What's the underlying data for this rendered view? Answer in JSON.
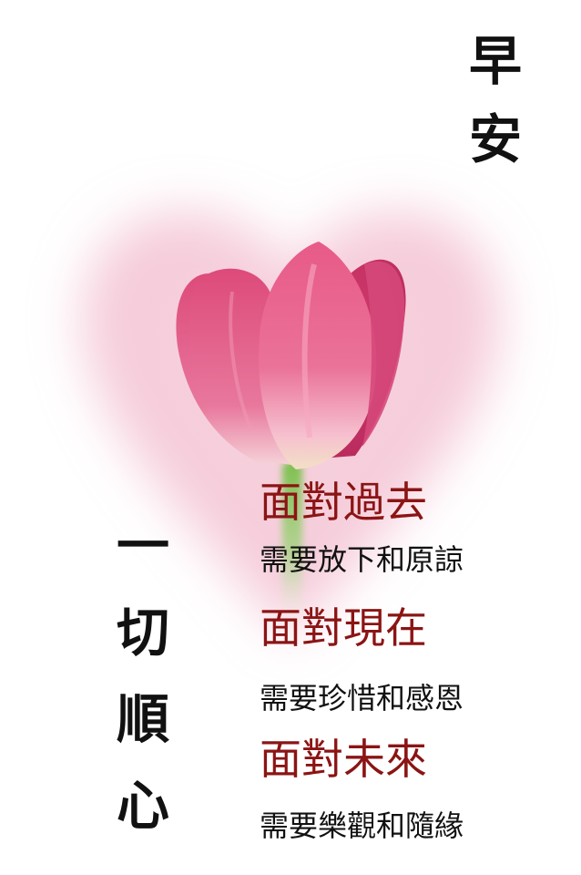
{
  "image": {
    "subject": "pink-tulip-on-pink-heart",
    "colors": {
      "heart_glow": "#f4c6d6",
      "petal_main": "#e0507a",
      "petal_light": "#f7b7c8",
      "stem": "#8fc862",
      "heading_red": "#8b1414",
      "text_black": "#111111"
    }
  },
  "greeting": {
    "chars": [
      "早",
      "安"
    ]
  },
  "wish": {
    "chars": [
      "一",
      "切",
      "順",
      "心"
    ]
  },
  "poem": [
    {
      "heading": "面對過去",
      "line": "需要放下和原諒"
    },
    {
      "heading": "面對現在",
      "line": "需要珍惜和感恩"
    },
    {
      "heading": "面對未來",
      "line": "需要樂觀和隨緣"
    }
  ]
}
